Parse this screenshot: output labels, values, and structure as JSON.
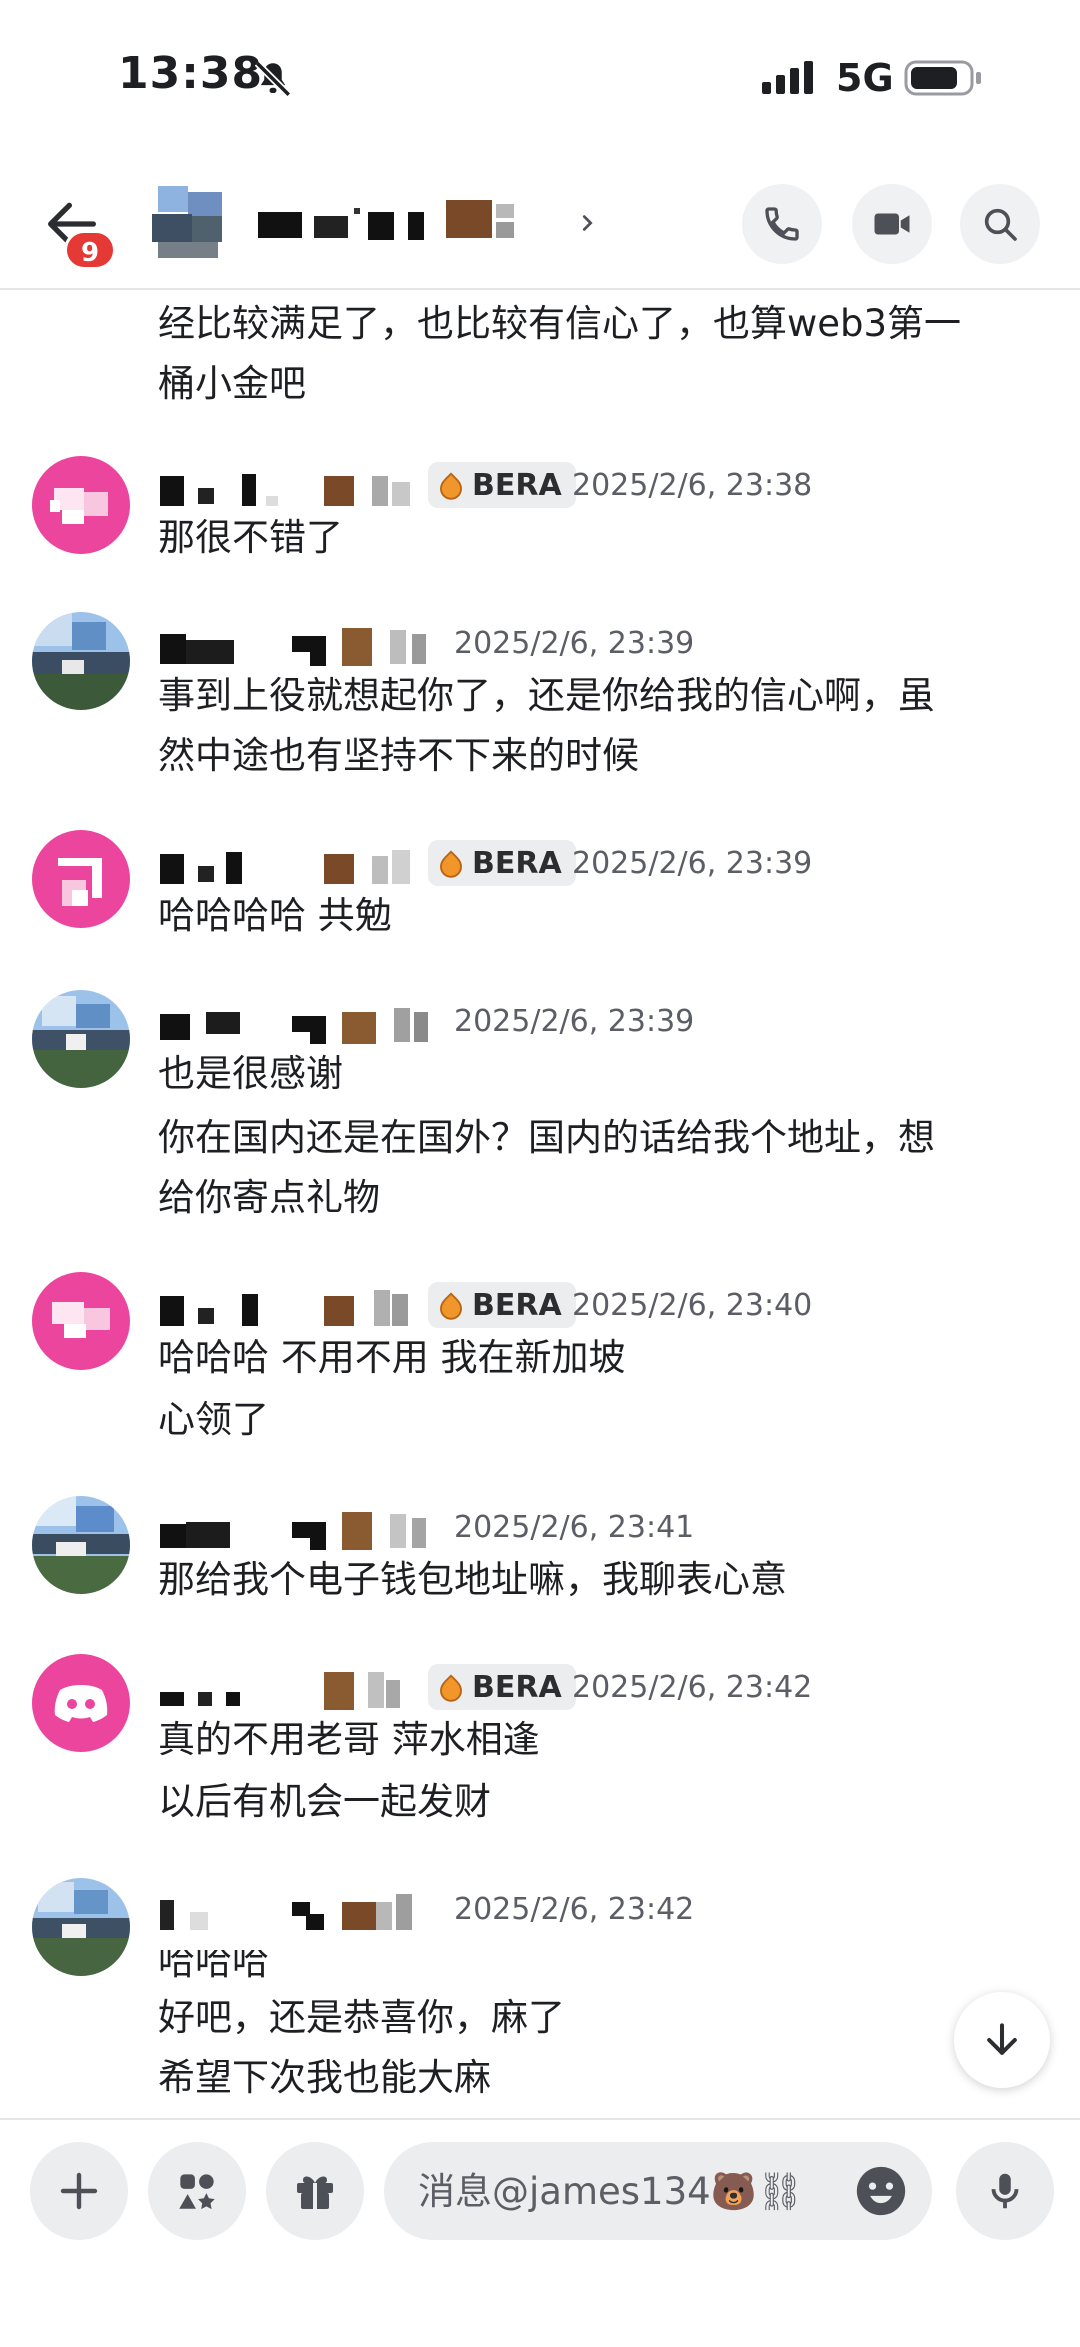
{
  "status_bar": {
    "time": "13:38",
    "network": "5G"
  },
  "header": {
    "unread_count": "9"
  },
  "messages": [
    {
      "id": "m0",
      "lines": [
        "经比较满足了，也比较有信心了，也算web3第一",
        "桶小金吧"
      ]
    },
    {
      "id": "m1",
      "badge": "BERA",
      "time": "2025/2/6, 23:38",
      "lines": [
        "那很不错了"
      ]
    },
    {
      "id": "m2",
      "time": "2025/2/6, 23:39",
      "lines": [
        "事到上役就想起你了，还是你给我的信心啊，虽",
        "然中途也有坚持不下来的时候"
      ]
    },
    {
      "id": "m3",
      "badge": "BERA",
      "time": "2025/2/6, 23:39",
      "lines": [
        "哈哈哈哈 共勉"
      ]
    },
    {
      "id": "m4",
      "time": "2025/2/6, 23:39",
      "lines": [
        "也是很感谢",
        "你在国内还是在国外？国内的话给我个地址，想",
        "给你寄点礼物"
      ]
    },
    {
      "id": "m5",
      "badge": "BERA",
      "time": "2025/2/6, 23:40",
      "lines": [
        "哈哈哈 不用不用 我在新加坡",
        "心领了"
      ]
    },
    {
      "id": "m6",
      "time": "2025/2/6, 23:41",
      "lines": [
        "那给我个电子钱包地址嘛，我聊表心意"
      ]
    },
    {
      "id": "m7",
      "badge": "BERA",
      "time": "2025/2/6, 23:42",
      "lines": [
        "真的不用老哥 萍水相逢",
        "以后有机会一起发财"
      ]
    },
    {
      "id": "m8",
      "time": "2025/2/6, 23:42",
      "lines": [
        "哈哈哈",
        "好吧，还是恭喜你，麻了",
        "希望下次我也能大麻"
      ]
    }
  ],
  "composer": {
    "placeholder": "消息@james134🐻⛓"
  },
  "colors": {
    "accent_pink": "#eb459e",
    "badge_red": "#e53935",
    "role_badge_bg": "#ebedef"
  },
  "icons": [
    "back-arrow-icon",
    "phone-icon",
    "video-camera-icon",
    "search-icon",
    "chevron-down-icon",
    "plus-icon",
    "apps-icon",
    "gift-icon",
    "emoji-icon",
    "microphone-icon"
  ]
}
